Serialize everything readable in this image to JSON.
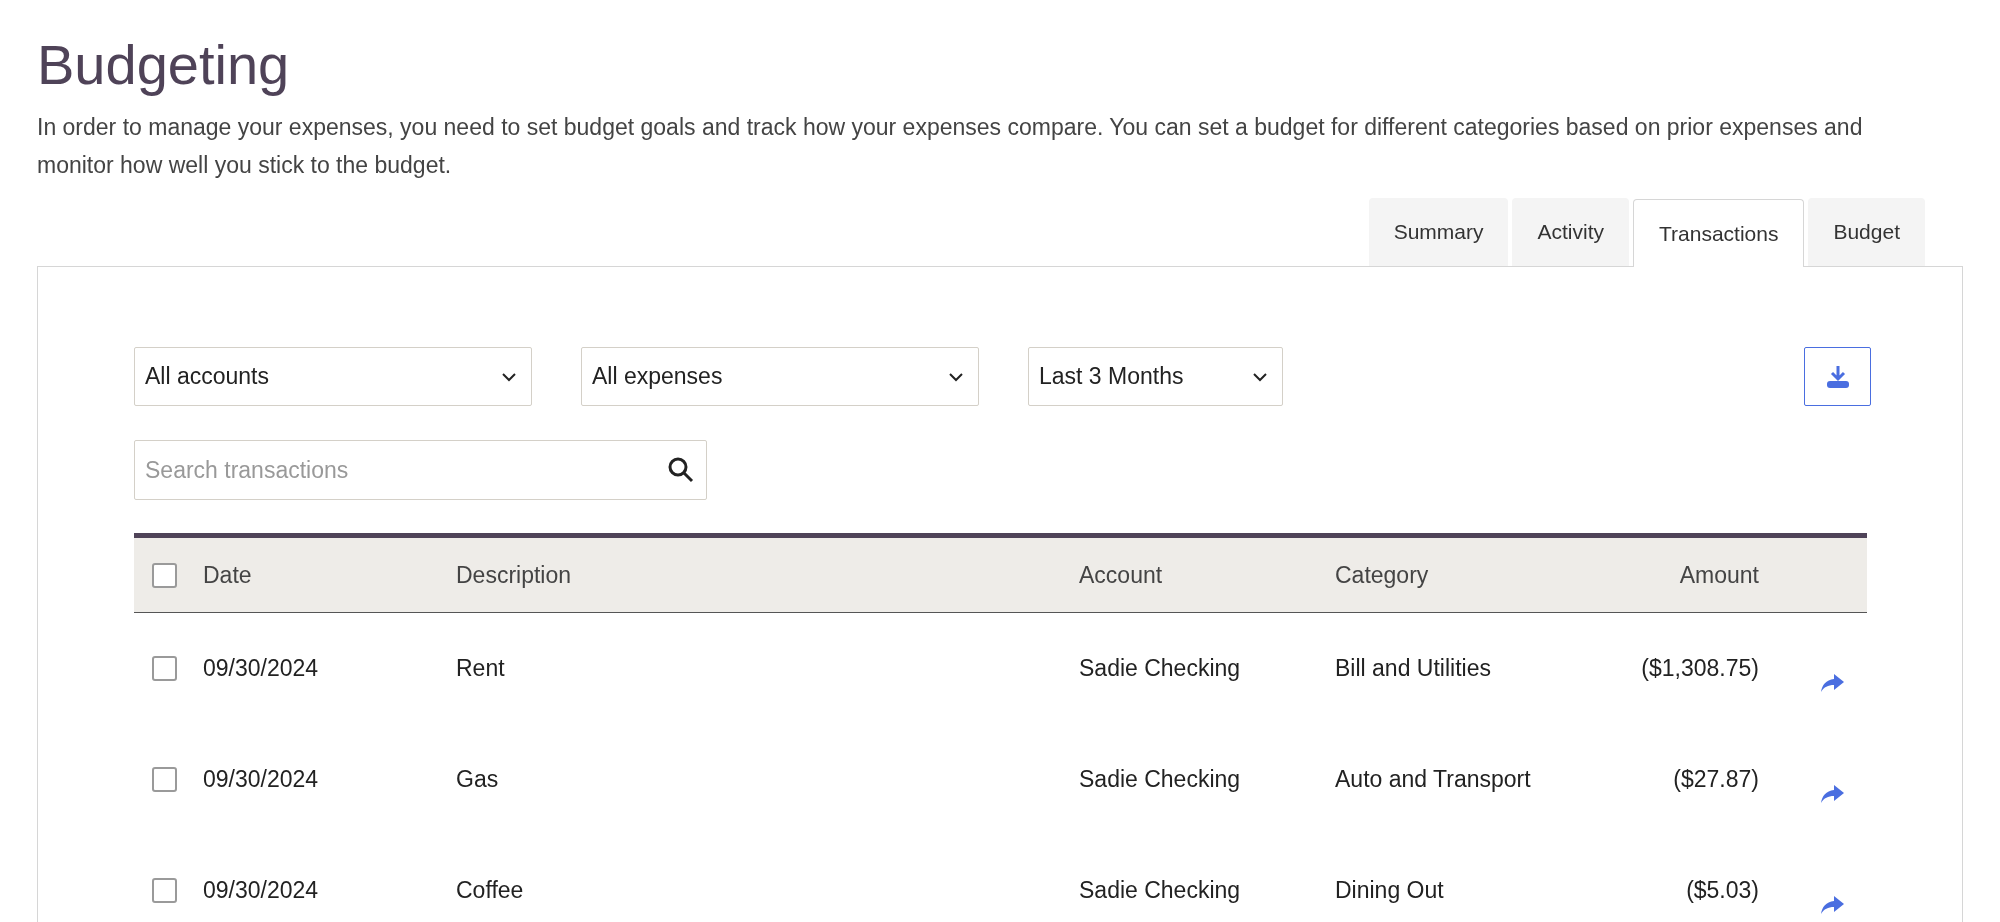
{
  "page": {
    "title": "Budgeting",
    "intro": "In order to manage your expenses, you need to set budget goals and track how your expenses compare. You can set a budget for different categories based on prior expenses and monitor how well you stick to the budget."
  },
  "tabs": [
    {
      "label": "Summary",
      "selected": false
    },
    {
      "label": "Activity",
      "selected": false
    },
    {
      "label": "Transactions",
      "selected": true
    },
    {
      "label": "Budget",
      "selected": false
    }
  ],
  "filters": [
    {
      "value": "All accounts"
    },
    {
      "value": "All expenses"
    },
    {
      "value": "Last 3 Months"
    }
  ],
  "search": {
    "placeholder": "Search transactions"
  },
  "table": {
    "select_all": {
      "checked": false
    },
    "columns": [
      "Date",
      "Description",
      "Account",
      "Category",
      "Amount"
    ],
    "rows": [
      {
        "checked": false,
        "date": "09/30/2024",
        "description": "Rent",
        "account": "Sadie Checking",
        "category": "Bill and Utilities",
        "amount": "($1,308.75)"
      },
      {
        "checked": false,
        "date": "09/30/2024",
        "description": "Gas",
        "account": "Sadie Checking",
        "category": "Auto and Transport",
        "amount": "($27.87)"
      },
      {
        "checked": false,
        "date": "09/30/2024",
        "description": "Coffee",
        "account": "Sadie Checking",
        "category": "Dining Out",
        "amount": "($5.03)"
      }
    ]
  }
}
